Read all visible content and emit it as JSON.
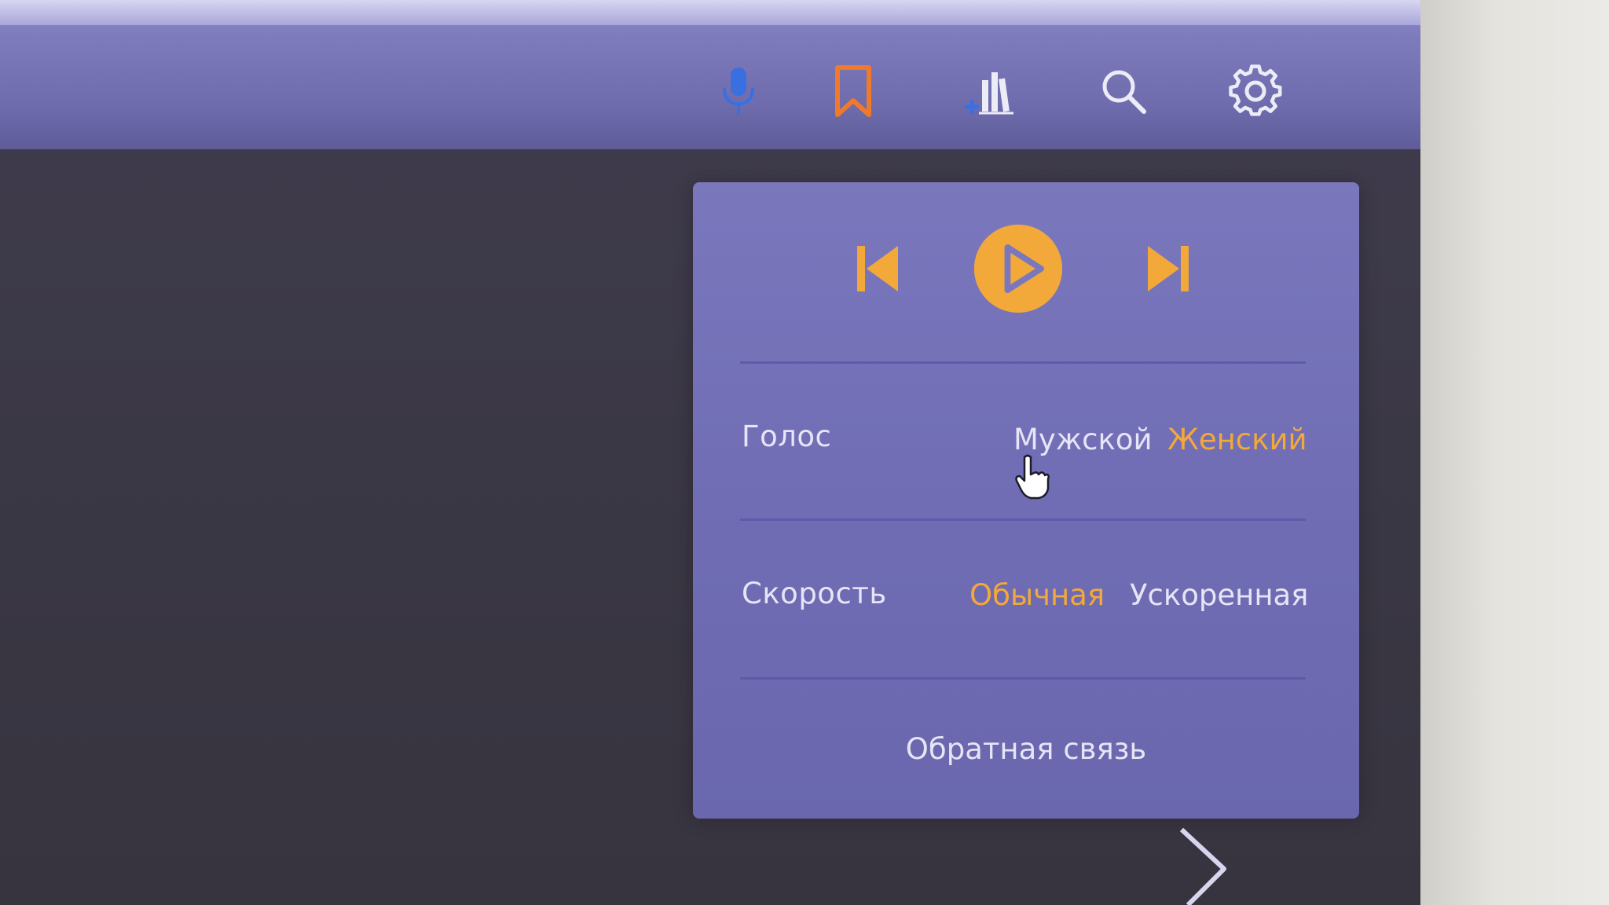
{
  "toolbar": {
    "icons": [
      {
        "name": "microphone-icon",
        "color": "#3a6fe0"
      },
      {
        "name": "bookmark-icon",
        "color": "#f07a2a"
      },
      {
        "name": "add-library-icon",
        "color": "#3a6fe0"
      },
      {
        "name": "search-icon",
        "color": "#ececf6"
      },
      {
        "name": "gear-icon",
        "color": "#ececf6"
      }
    ]
  },
  "player": {
    "controls": [
      "previous-track-icon",
      "play-icon",
      "next-track-icon"
    ],
    "accent_color": "#f2a93a",
    "voice": {
      "label": "Голос",
      "options": [
        {
          "label": "Мужской",
          "active": false
        },
        {
          "label": "Женский",
          "active": true
        }
      ]
    },
    "speed": {
      "label": "Скорость",
      "options": [
        {
          "label": "Обычная",
          "active": true
        },
        {
          "label": "Ускоренная",
          "active": false
        }
      ]
    },
    "feedback_label": "Обратная связь"
  },
  "navigation": {
    "next_icon": "chevron-right-icon"
  }
}
